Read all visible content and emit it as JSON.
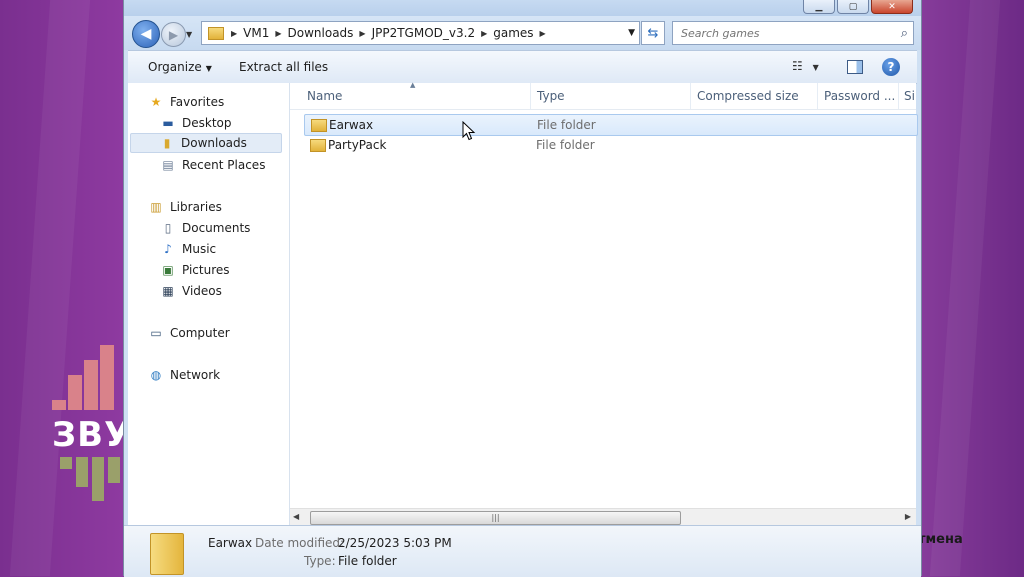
{
  "window": {
    "controls": [
      "minimize",
      "maximize",
      "close"
    ]
  },
  "nav": {
    "breadcrumbs": [
      "VM1",
      "Downloads",
      "JPP2TGMOD_v3.2",
      "games"
    ],
    "search_placeholder": "Search games"
  },
  "toolbar": {
    "organize_label": "Organize",
    "extract_label": "Extract all files"
  },
  "sidebar": {
    "favorites_label": "Favorites",
    "favorites": [
      "Desktop",
      "Downloads",
      "Recent Places"
    ],
    "libraries_label": "Libraries",
    "libraries": [
      "Documents",
      "Music",
      "Pictures",
      "Videos"
    ],
    "computer_label": "Computer",
    "network_label": "Network"
  },
  "columns": {
    "name": "Name",
    "type": "Type",
    "compressed_size": "Compressed size",
    "password": "Password ...",
    "extra": "Si"
  },
  "files": [
    {
      "name": "Earwax",
      "type": "File folder"
    },
    {
      "name": "PartyPack",
      "type": "File folder"
    }
  ],
  "details": {
    "name": "Earwax",
    "date_label": "Date modified:",
    "date_value": "2/25/2023 5:03 PM",
    "type_label": "Type:",
    "type_value": "File folder"
  },
  "watermark": {
    "logo_text": "ЗВУ",
    "right_text": "тмена"
  },
  "colors": {
    "background": "#9a45a8",
    "selection": "#d9e9fb",
    "folder": "#e2b23a"
  }
}
